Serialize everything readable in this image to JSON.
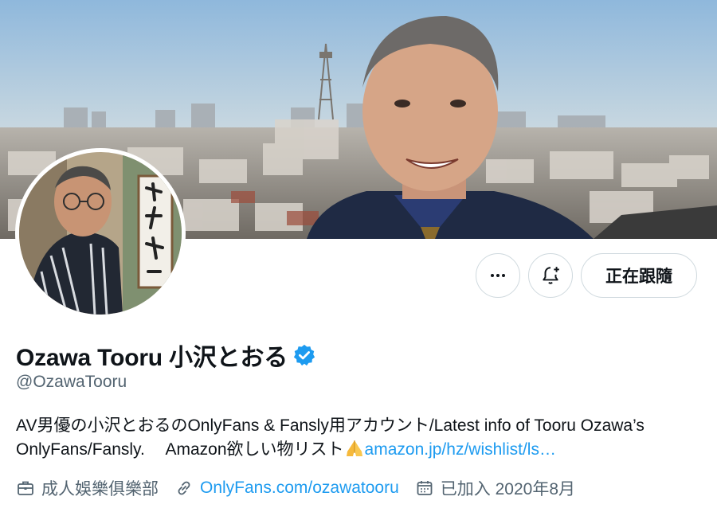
{
  "profile": {
    "display_name": "Ozawa Tooru 小沢とおる",
    "handle": "@OzawaTooru",
    "verified": true,
    "bio_text_1": "AV男優の小沢とおるのOnlyFans & Fansly用アカウント/Latest info of Tooru Ozawa’s OnlyFans/Fansly.　 Amazon欲しい物リスト",
    "bio_link": "amazon.jp/hz/wishlist/ls…",
    "category": "成人娛樂俱樂部",
    "website": "OnlyFans.com/ozawatooru",
    "joined": "已加入 2020年8月"
  },
  "actions": {
    "more_label": "…",
    "follow_label": "正在跟隨"
  },
  "icons": {
    "more": "more-icon",
    "notify": "bell-plus-icon",
    "verified": "verified-badge-icon",
    "category": "briefcase-icon",
    "link": "link-icon",
    "calendar": "calendar-icon",
    "pray": "folded-hands-emoji"
  },
  "colors": {
    "accent": "#1d9bf0",
    "secondary_text": "#536471",
    "border": "#cfd9de"
  }
}
